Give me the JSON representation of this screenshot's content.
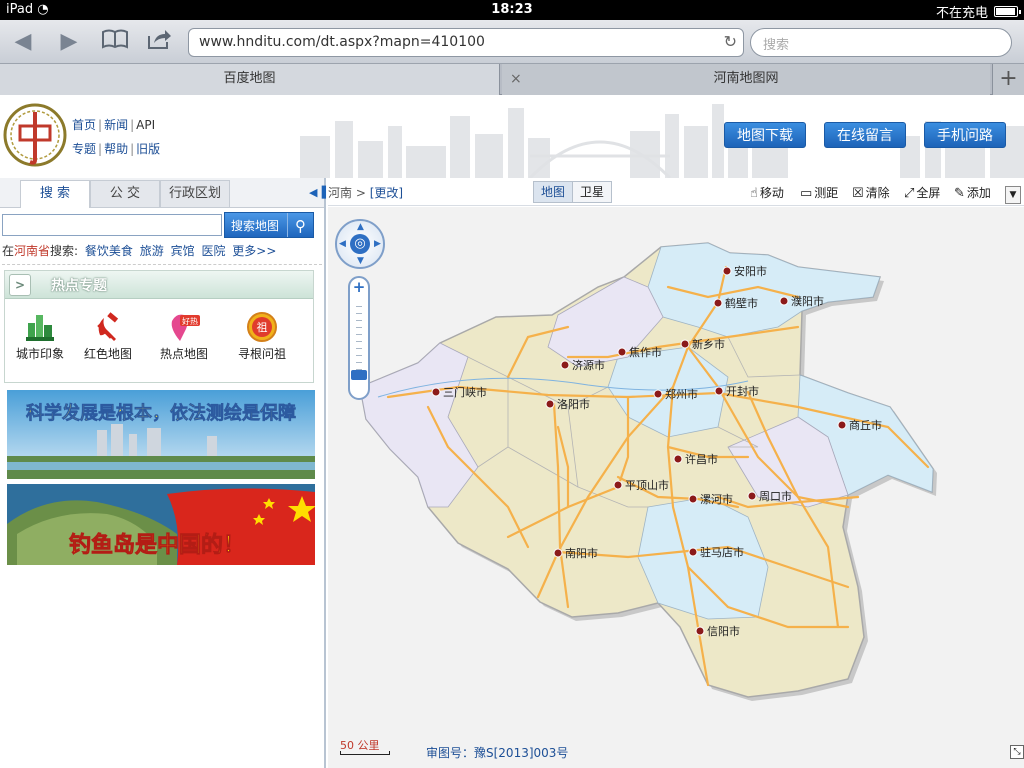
{
  "status": {
    "device": "iPad",
    "time": "18:23",
    "charging": "不在充电"
  },
  "browser": {
    "url": "www.hnditu.com/dt.aspx?mapn=410100",
    "search_placeholder": "搜索",
    "tabs": [
      {
        "label": "百度地图"
      },
      {
        "label": "河南地图网"
      }
    ],
    "close_glyph": "×",
    "new_tab_glyph": "+"
  },
  "header": {
    "links_row1": [
      "首页",
      "新闻",
      "API"
    ],
    "links_row2": [
      "专题",
      "帮助",
      "旧版"
    ],
    "buttons": [
      "地图下载",
      "在线留言",
      "手机问路"
    ]
  },
  "sidebar": {
    "tabs": [
      "搜 索",
      "公 交",
      "行政区划"
    ],
    "search_button": "搜索地图",
    "quick_search_prefix": "在",
    "province": "河南省",
    "quick_search_suffix": "搜索:",
    "quick_links": [
      "餐饮美食",
      "旅游",
      "宾馆",
      "医院",
      "更多>>"
    ],
    "hot_topics_title": "热点专题",
    "hot_items": [
      {
        "label": "城市印象",
        "icon": "city-icon"
      },
      {
        "label": "红色地图",
        "icon": "hammer-sickle-icon"
      },
      {
        "label": "热点地图",
        "icon": "hot-pin-icon",
        "badge": "好热"
      },
      {
        "label": "寻根问祖",
        "icon": "ancestor-icon",
        "badge": "祖"
      }
    ],
    "banner1_text": "科学发展是根本，依法测绘是保障",
    "banner2_text": "钓鱼岛是中国的！"
  },
  "mapbar": {
    "crumb_region": "河南",
    "crumb_sep": ">",
    "crumb_change": "[更改]",
    "map_types": [
      "地图",
      "卫星"
    ],
    "tools": [
      {
        "label": "移动",
        "icon": "hand-icon"
      },
      {
        "label": "测距",
        "icon": "ruler-icon"
      },
      {
        "label": "清除",
        "icon": "clear-icon"
      },
      {
        "label": "全屏",
        "icon": "fullscreen-icon"
      },
      {
        "label": "添加",
        "icon": "pin-icon"
      }
    ]
  },
  "map": {
    "scale_label": "50 公里",
    "approval": "审图号：豫S[2013]003号",
    "cities": [
      {
        "name": "安阳市"
      },
      {
        "name": "鹤壁市"
      },
      {
        "name": "濮阳市"
      },
      {
        "name": "焦作市"
      },
      {
        "name": "新乡市"
      },
      {
        "name": "济源市"
      },
      {
        "name": "三门峡市"
      },
      {
        "name": "洛阳市"
      },
      {
        "name": "郑州市"
      },
      {
        "name": "开封市"
      },
      {
        "name": "商丘市"
      },
      {
        "name": "许昌市"
      },
      {
        "name": "平顶山市"
      },
      {
        "name": "漯河市"
      },
      {
        "name": "周口市"
      },
      {
        "name": "南阳市"
      },
      {
        "name": "驻马店市"
      },
      {
        "name": "信阳市"
      }
    ],
    "colors": {
      "region_blue": "#d6ecf7",
      "region_yellow": "#ede8c8",
      "region_lavender": "#e9e6f4",
      "roads": "#f5b14b",
      "city_dot": "#8b1a1a"
    }
  }
}
